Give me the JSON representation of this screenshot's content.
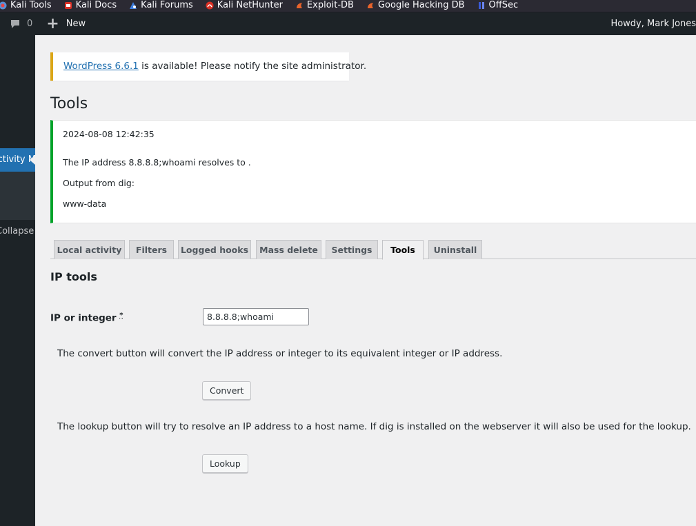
{
  "bookmarks": [
    {
      "label": "Kali Tools",
      "icon": "kali-tools-icon",
      "color": "#5b8fd6"
    },
    {
      "label": "Kali Docs",
      "icon": "kali-docs-icon",
      "color": "#d93025"
    },
    {
      "label": "Kali Forums",
      "icon": "kali-forums-icon",
      "color": "#3d7ee0"
    },
    {
      "label": "Kali NetHunter",
      "icon": "kali-nethunter-icon",
      "color": "#d93025"
    },
    {
      "label": "Exploit-DB",
      "icon": "exploit-db-icon",
      "color": "#e8632b"
    },
    {
      "label": "Google Hacking DB",
      "icon": "google-hacking-db-icon",
      "color": "#e8632b"
    },
    {
      "label": "OffSec",
      "icon": "offsec-icon",
      "color": "#3a5bd9"
    }
  ],
  "adminbar": {
    "comments_count": "0",
    "new_label": "New",
    "howdy": "Howdy, Mark Jones"
  },
  "sidebar": {
    "active_label": "Activity Monitor",
    "text_item": "Collapse menu"
  },
  "notice": {
    "link_text": "WordPress 6.6.1",
    "message": " is available! Please notify the site administrator."
  },
  "page": {
    "title": "Tools"
  },
  "result": {
    "timestamp": "2024-08-08 12:42:35",
    "resolve_line": "The IP address 8.8.8.8;whoami resolves to .",
    "dig_label": "Output from dig:",
    "dig_output": "www-data"
  },
  "tabs": [
    {
      "label": "Local activity",
      "active": false
    },
    {
      "label": "Filters",
      "active": false
    },
    {
      "label": "Logged hooks",
      "active": false
    },
    {
      "label": "Mass delete",
      "active": false
    },
    {
      "label": "Settings",
      "active": false
    },
    {
      "label": "Tools",
      "active": true
    },
    {
      "label": "Uninstall",
      "active": false
    }
  ],
  "ip_tools": {
    "section_title": "IP tools",
    "field_label": "IP or integer",
    "required_mark": "*",
    "input_value": "8.8.8.8;whoami",
    "convert_desc": "The convert button will convert the IP address or integer to its equivalent integer or IP address.",
    "convert_label": "Convert",
    "lookup_desc": "The lookup button will try to resolve an IP address to a host name. If dig is installed on the webserver it will also be used for the lookup.",
    "lookup_label": "Lookup"
  },
  "colors": {
    "accent": "#2271b1",
    "success": "#00a32a",
    "warning": "#dba617",
    "admin_dark": "#1d2327"
  }
}
